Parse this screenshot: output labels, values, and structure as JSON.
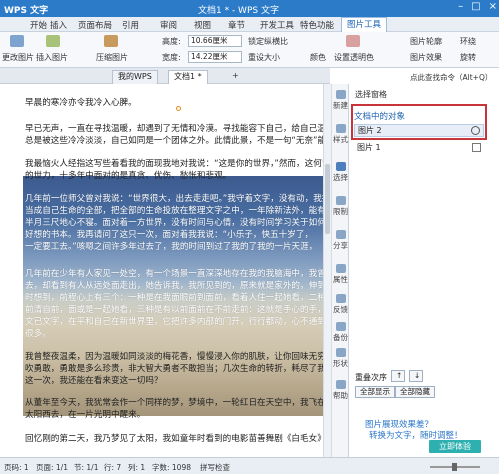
{
  "app": {
    "logo": "WPS 文字",
    "doc_title": "文档1 * - WPS 文字",
    "win_buttons": [
      "–",
      "□",
      "×"
    ]
  },
  "menu": {
    "items": [
      "开始",
      "插入",
      "页面布局",
      "引用",
      "审阅",
      "视图",
      "章节",
      "开发工具",
      "特色功能",
      "图片工具"
    ],
    "active": "图片工具"
  },
  "ribbon": {
    "change_pic": "更改图片",
    "insert_pic": "插入图片",
    "compress": "压缩图片",
    "height_label": "高度:",
    "height_value": "10.66厘米",
    "width_label": "宽度:",
    "width_value": "14.22厘米",
    "lock_ratio": "锁定纵横比",
    "reset_size": "重设大小",
    "color": "颜色",
    "set_transparent": "设置透明色",
    "brightness": "图片轮廓",
    "effects": "图片效果",
    "wrap": "环绕",
    "rotate": "旋转",
    "align": "对齐",
    "combine": "组合"
  },
  "tabs": {
    "wps": "我的WPS",
    "doc": "文档1 *",
    "plus": "+",
    "help": "点此查找命令（Alt+Q）"
  },
  "document": {
    "lines": [
      "早晨的寒冷亦令我冷入心脾。",
      "早已无声，一直在寻找温暖，却遇到了无情和冷漠。寻找能容下自己，给自己温暖",
      "总是被这些冷冷淡淡，自己如同是一个团体之外。此情此景，不是一句“无奈”能够",
      "我最恼火人经指这写些着看我的面现我地对我说：“这是你的世界，”然而，这何曾",
      "的世力，十多年中面对的是真贪、优伤、愁怅和悲观。",
      "几年前一位师父曾对我说：“世界很大，出去走走吧。”我守着文字，没有动，我把",
      "当成自己生命的全部，把全部的生命投放在整理文字之中，一年除新法外，能有",
      "半月三尺地心不寝。面对着一方世界，没有时间与心情，没有时间学习关于如何",
      "好想的书本。我再请问了这只一次，面对着我我说：“小乐子，快五十岁了，",
      "一定要工去。”咳嗯之间许多年过去了，我的时间到过了我的了我的一片天涯，",
      "几年前在少年有人家见一处空，有一个场景一直深深地存在我的我脑海中，我曾每到",
      "去，却看到有人从远处面走出，她告诉我，我所见到的，原来就是家外的，伸到多",
      "时想到，前程心上有三个：一种是在我面眼前到面前，看着人住一起她看，二种是",
      "前清自前，面或是一起她看，三种是有以前面前在不前走前：这就是手心的手，",
      "文已文字，在平和自己在新世界里，它把许多内部的门开，行行都动，心不通到我",
      "很多。",
      "我曾整夜温柔，因为温暖如同淡淡的梅花香，慢慢浸入你的肌肤，让你回味无穷，也",
      "吹勇敢，勇敢是多么珍贵，非大智大勇者不敢担当；几次生命的转折，耗尽了我所有",
      "这一次，我还能在看来变这一切吗？",
      "从董年至今天，我犹常会作一个同样的梦，梦境中，一轮红日在天空中，我飞在空",
      "太阳西去，在一片光明中醒来。",
      "回忆刚的第二天，我乃梦见了太阳，我如童年时看到的电影苗善舞剧《白毛女》中"
    ]
  },
  "sidetools": [
    "新建",
    "样式",
    "选择",
    "限制",
    "分享",
    "属性",
    "反馈",
    "备份",
    "形状",
    "帮助"
  ],
  "pane": {
    "header": "选择窗格",
    "objects_title": "文档中的对象",
    "objects": [
      {
        "name": "图片 2",
        "visible": true,
        "selected": true
      },
      {
        "name": "图片 1",
        "visible": false,
        "selected": false
      }
    ],
    "reorder_label": "重叠次序",
    "show_all": "全部显示",
    "hide_all": "全部隐藏",
    "promo_line1": "图片展现效果差？",
    "promo_line2": "转换为文字，随时调整！",
    "try_button": "立即体验"
  },
  "statusbar": {
    "page": "页码: 1",
    "pages": "页面: 1/1",
    "section": "节: 1/1",
    "row": "行: 7",
    "col": "列: 1",
    "words": "字数: 1098",
    "spell": "拼写检查"
  },
  "colors": {
    "accent": "#2b7bc9",
    "highlight_box": "#c9333a",
    "promo": "#2a76c9",
    "try_btn": "#2fb0b0"
  }
}
